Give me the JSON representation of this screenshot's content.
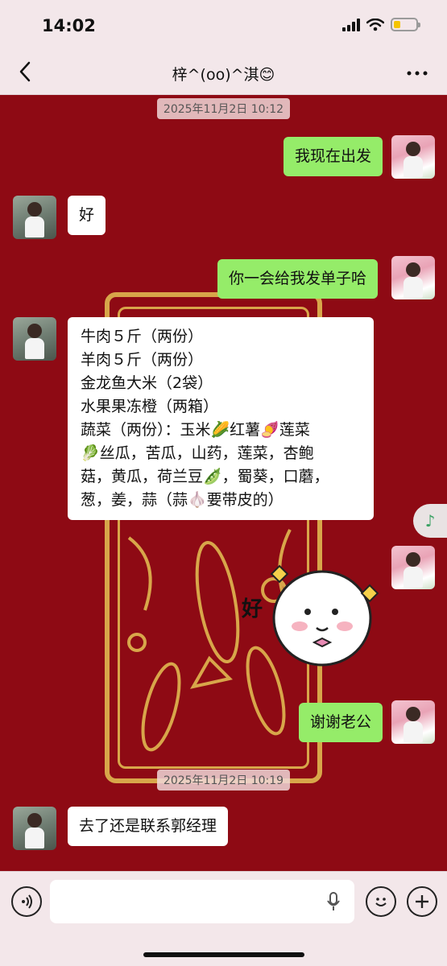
{
  "status_bar": {
    "time": "14:02",
    "battery_level": 0.3
  },
  "header": {
    "title": "梓^(oo)^淇😊",
    "back_icon": "chevron-left-icon",
    "more_icon": "more-dots-icon"
  },
  "timestamps": [
    "2025年11月2日 10:12",
    "2025年11月2日 10:19"
  ],
  "messages": [
    {
      "side": "right",
      "text": "我现在出发"
    },
    {
      "side": "left",
      "text": "好"
    },
    {
      "side": "right",
      "text": "你一会给我发单子哈"
    },
    {
      "side": "left",
      "lines": [
        "牛肉５斤（两份）",
        "羊肉５斤（两份）",
        "金龙鱼大米（2袋）",
        "水果果冻橙（两箱）",
        "蔬菜（两份）：玉米🌽红薯🍠莲菜",
        "🥬丝瓜，苦瓜，山药，莲菜，杏鲍",
        "菇，黄瓜，荷兰豆🫛，蜀葵，口蘑，",
        "葱，姜，蒜（蒜🧄要带皮的）"
      ]
    },
    {
      "side": "right",
      "sticker": "好"
    },
    {
      "side": "right",
      "text": "谢谢老公"
    },
    {
      "side": "left",
      "text": "去了还是联系郭经理"
    }
  ],
  "float_button": {
    "icon": "music-note-icon",
    "glyph": "♪"
  },
  "input_bar": {
    "voice_icon": "voice-icon",
    "mic_icon": "mic-icon",
    "emoji_icon": "emoji-icon",
    "plus_icon": "plus-icon",
    "placeholder": ""
  },
  "colors": {
    "chat_bg": "#8e0a14",
    "me_bubble": "#95ec69",
    "them_bubble": "#ffffff",
    "gold": "#d8a64a"
  }
}
